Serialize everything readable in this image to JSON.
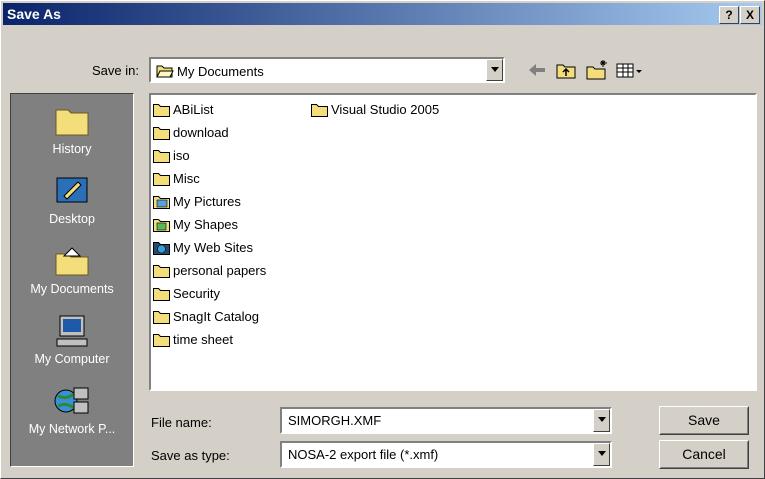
{
  "window": {
    "title": "Save As",
    "help_label": "?",
    "close_label": "X"
  },
  "save_in": {
    "label": "Save in:",
    "value": "My Documents"
  },
  "toolbar": {
    "back_icon": "back-arrow-icon",
    "up_icon": "up-folder-icon",
    "new_folder_icon": "new-folder-icon",
    "views_icon": "views-menu-icon"
  },
  "places": [
    {
      "label": "History",
      "icon": "history-icon"
    },
    {
      "label": "Desktop",
      "icon": "desktop-icon"
    },
    {
      "label": "My Documents",
      "icon": "my-documents-icon"
    },
    {
      "label": "My Computer",
      "icon": "my-computer-icon"
    },
    {
      "label": "My Network P...",
      "icon": "network-places-icon"
    }
  ],
  "files_col1": [
    {
      "name": "ABiList",
      "icon": "folder"
    },
    {
      "name": "download",
      "icon": "folder"
    },
    {
      "name": "iso",
      "icon": "folder"
    },
    {
      "name": "Misc",
      "icon": "folder"
    },
    {
      "name": "My Pictures",
      "icon": "pictures-folder"
    },
    {
      "name": "My Shapes",
      "icon": "shapes-folder"
    },
    {
      "name": "My Web Sites",
      "icon": "websites-folder"
    },
    {
      "name": "personal papers",
      "icon": "folder"
    },
    {
      "name": "Security",
      "icon": "folder"
    },
    {
      "name": "SnagIt Catalog",
      "icon": "folder"
    },
    {
      "name": "time sheet",
      "icon": "folder"
    }
  ],
  "files_col2": [
    {
      "name": "Visual Studio 2005",
      "icon": "folder"
    }
  ],
  "file_name": {
    "label": "File name:",
    "value": "SIMORGH.XMF"
  },
  "save_as_type": {
    "label": "Save as type:",
    "value": "NOSA-2 export file (*.xmf)"
  },
  "buttons": {
    "save": "Save",
    "cancel": "Cancel"
  },
  "colors": {
    "titlebar_start": "#0a246a",
    "titlebar_end": "#a6caf0",
    "face": "#d4d0c8",
    "places_bg": "#808080",
    "folder": "#f4de7c"
  }
}
